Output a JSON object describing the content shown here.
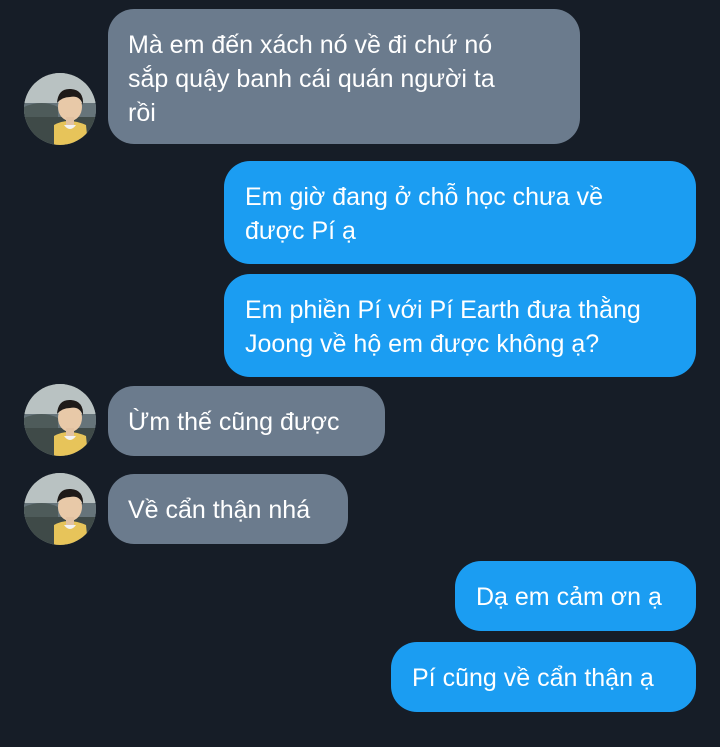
{
  "colors": {
    "background": "#161d27",
    "incoming_bubble": "#6b7b8d",
    "outgoing_bubble": "#1b9df2",
    "text": "#ffffff"
  },
  "messages": [
    {
      "direction": "incoming",
      "has_avatar": true,
      "text": "Mà em đến xách nó về đi chứ nó\nsắp quậy banh cái quán người ta\nrồi"
    },
    {
      "direction": "outgoing",
      "has_avatar": false,
      "text": "Em giờ đang ở chỗ học chưa về\nđược Pí ạ"
    },
    {
      "direction": "outgoing",
      "has_avatar": false,
      "text": "Em phiền Pí với Pí Earth đưa thằng\nJoong về hộ em được không ạ?"
    },
    {
      "direction": "incoming",
      "has_avatar": true,
      "text": "Ừm thế cũng được"
    },
    {
      "direction": "incoming",
      "has_avatar": true,
      "text": "Về cẩn thận nhá"
    },
    {
      "direction": "outgoing",
      "has_avatar": false,
      "text": "Dạ em cảm ơn ạ"
    },
    {
      "direction": "outgoing",
      "has_avatar": false,
      "text": "Pí cũng về cẩn thận ạ"
    }
  ]
}
